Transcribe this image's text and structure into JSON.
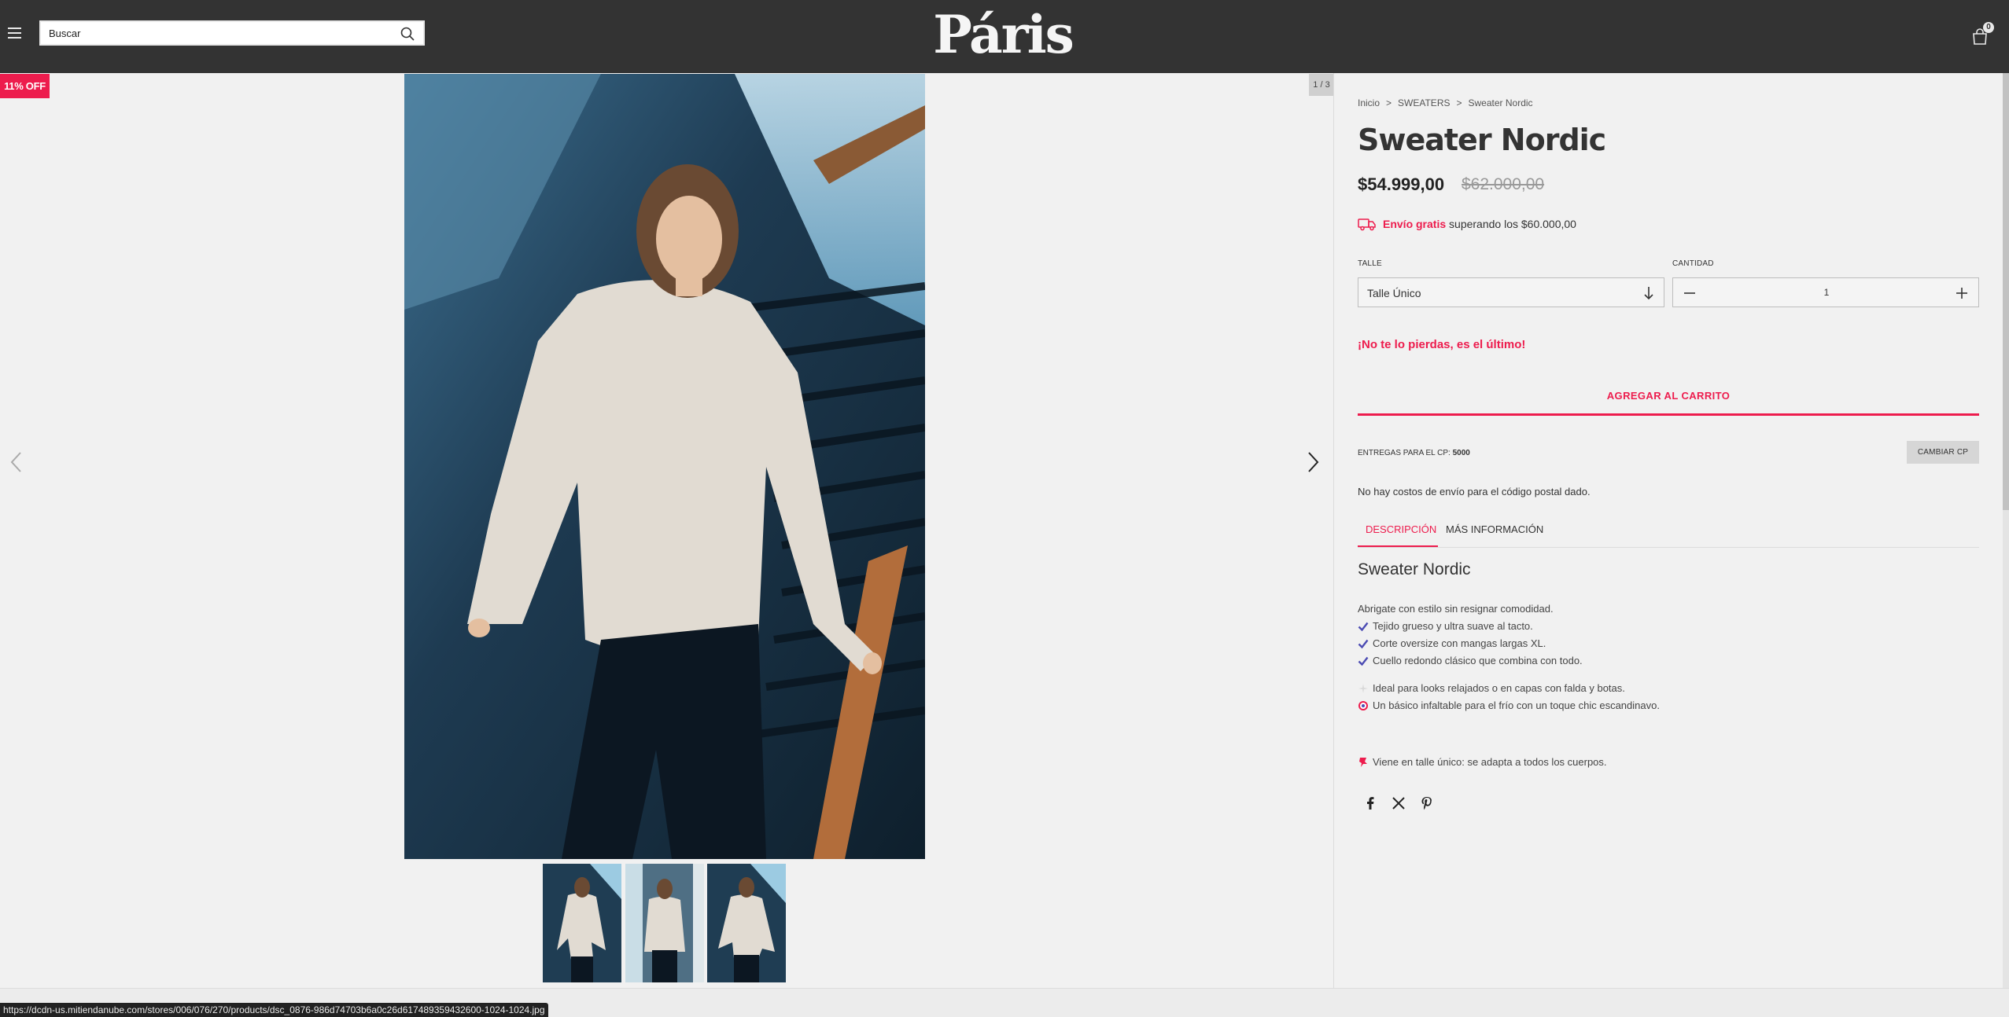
{
  "header": {
    "search_placeholder": "Buscar",
    "logo": "Páris",
    "cart_count": "0"
  },
  "gallery": {
    "discount_badge": "11% OFF",
    "counter": "1 / 3"
  },
  "breadcrumb": {
    "home": "Inicio",
    "separator": ">",
    "category": "SWEATERS",
    "current": "Sweater Nordic"
  },
  "product": {
    "title": "Sweater Nordic",
    "price": "$54.999,00",
    "price_old": "$62.000,00",
    "free_shipping_strong": "Envío gratis",
    "free_shipping_rest": "superando los $60.000,00",
    "size_label": "TALLE",
    "size_value": "Talle Único",
    "qty_label": "CANTIDAD",
    "qty_value": "1",
    "last_one": "¡No te lo pierdas, es el último!",
    "add_to_cart": "AGREGAR AL CARRITO",
    "delivery_prefix": "ENTREGAS PARA EL CP:",
    "delivery_cp": "5000",
    "change_cp": "CAMBIAR CP",
    "no_cost": "No hay costos de envío para el código postal dado."
  },
  "tabs": {
    "description": "DESCRIPCIÓN",
    "more_info": "MÁS INFORMACIÓN"
  },
  "description": {
    "title": "Sweater Nordic",
    "intro": "Abrigate con estilo sin resignar comodidad.",
    "features": [
      "Tejido grueso y ultra suave al tacto.",
      "Corte oversize con mangas largas XL.",
      "Cuello redondo clásico que combina con todo."
    ],
    "ideal": "Ideal para looks relajados o en capas con falda y botas.",
    "basic": "Un básico infaltable para el frío con un toque chic escandinavo.",
    "size_note": "Viene en talle único: se adapta a todos los cuerpos."
  },
  "status_url": "https://dcdn-us.mitiendanube.com/stores/006/076/270/products/dsc_0876-986d74703b6a0c26d617489359432600-1024-1024.jpg",
  "colors": {
    "header_bg": "#333333",
    "accent": "#ed1c4d",
    "check": "#4b4bb3"
  }
}
